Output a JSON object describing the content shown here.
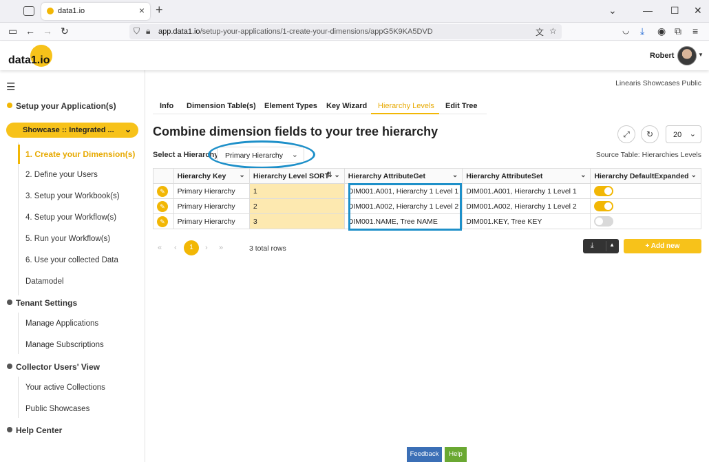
{
  "browser": {
    "tab_title": "data1.io",
    "url_host": "app.data1.io",
    "url_path": "/setup-your-applications/1-create-your-dimensions/appG5K9KA5DVD"
  },
  "header": {
    "logo_text": "data1.io",
    "user_name": "Robert"
  },
  "sidebar": {
    "section_setup": "Setup your Application(s)",
    "showcase_button": "Showcase :: Integrated ...",
    "setup_items": [
      "1. Create your Dimension(s)",
      "2. Define your Users",
      "3. Setup your Workbook(s)",
      "4. Setup your Workflow(s)",
      "5. Run your Workflow(s)",
      "6. Use your collected Data",
      "Datamodel"
    ],
    "section_tenant": "Tenant Settings",
    "tenant_items": [
      "Manage Applications",
      "Manage Subscriptions"
    ],
    "section_collector": "Collector Users' View",
    "collector_items": [
      "Your active Collections",
      "Public Showcases"
    ],
    "section_help": "Help Center"
  },
  "main": {
    "showcase_label": "Linearis Showcases Public",
    "tabs": [
      "Info",
      "Dimension Table(s)",
      "Element Types",
      "Key Wizard",
      "Hierarchy Levels",
      "Edit Tree"
    ],
    "active_tab": "Hierarchy Levels",
    "title": "Combine dimension fields to your tree hierarchy",
    "page_size": "20",
    "select_label": "Select a Hierarchy",
    "select_value": "Primary Hierarchy",
    "source_table": "Source Table: Hierarchies Levels",
    "columns": [
      "Hierarchy Key",
      "Hierarchy Level SORT",
      "Hierarchy AttributeGet",
      "Hierarchy AttributeSet",
      "Hierarchy DefaultExpanded"
    ],
    "rows": [
      {
        "key": "Primary Hierarchy",
        "sort": "1",
        "get": "DIM001.A001, Hierarchy 1 Level 1",
        "set": "DIM001.A001, Hierarchy 1 Level 1",
        "expanded": true
      },
      {
        "key": "Primary Hierarchy",
        "sort": "2",
        "get": "DIM001.A002, Hierarchy 1 Level 2",
        "set": "DIM001.A002, Hierarchy 1 Level 2",
        "expanded": true
      },
      {
        "key": "Primary Hierarchy",
        "sort": "3",
        "get": "DIM001.NAME, Tree NAME",
        "set": "DIM001.KEY, Tree KEY",
        "expanded": false
      }
    ],
    "current_page": "1",
    "total_rows": "3 total rows",
    "add_new": "+ Add new"
  },
  "footer": {
    "feedback": "Feedback",
    "help": "Help"
  },
  "colors": {
    "accent": "#f2b705",
    "highlight": "#1e90c9"
  }
}
